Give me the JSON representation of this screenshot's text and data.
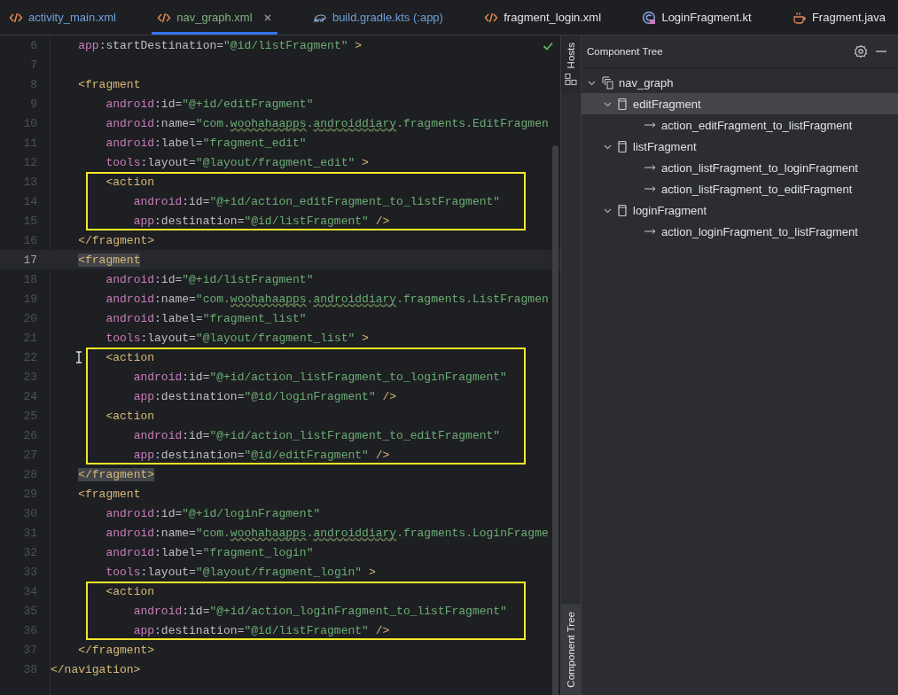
{
  "tabs": [
    {
      "label": "activity_main.xml",
      "kind": "xml",
      "selected": false,
      "closable": false,
      "color": "#6f9fd8"
    },
    {
      "label": "nav_graph.xml",
      "kind": "xml",
      "selected": true,
      "closable": true,
      "color": "#7fb07f"
    },
    {
      "label": "build.gradle.kts (:app)",
      "kind": "gradle",
      "selected": false,
      "closable": false,
      "color": "#6f9fd8"
    },
    {
      "label": "fragment_login.xml",
      "kind": "xml",
      "selected": false,
      "closable": false,
      "color": "#dfe1e5"
    },
    {
      "label": "LoginFragment.kt",
      "kind": "kotlin",
      "selected": false,
      "closable": false,
      "color": "#dfe1e5"
    },
    {
      "label": "Fragment.java",
      "kind": "java",
      "selected": false,
      "closable": false,
      "color": "#dfe1e5"
    }
  ],
  "editor": {
    "no_problems": true,
    "blocks": [
      {
        "boxed": false,
        "lines": [
          {
            "number": "6",
            "current": false,
            "tokens": [
              {
                "kind": "ns",
                "text": "    app"
              },
              {
                "kind": "plain",
                "text": ":startDestination="
              },
              {
                "kind": "value",
                "text": "\"@id/listFragment\""
              },
              {
                "kind": "tag",
                "text": " >"
              }
            ]
          },
          {
            "number": "7",
            "current": false
          },
          {
            "number": "8",
            "current": false,
            "tokens": [
              {
                "kind": "tag",
                "text": "    <fragment"
              }
            ]
          },
          {
            "number": "9",
            "current": false,
            "tokens": [
              {
                "kind": "ns",
                "text": "        android"
              },
              {
                "kind": "plain",
                "text": ":id="
              },
              {
                "kind": "value",
                "text": "\"@+id/editFragment\""
              }
            ]
          },
          {
            "number": "10",
            "current": false,
            "tokens": [
              {
                "kind": "ns",
                "text": "        android"
              },
              {
                "kind": "plain",
                "text": ":name="
              },
              {
                "kind": "value",
                "text": "\"com."
              },
              {
                "kind": "typo",
                "text": "woohahaapps"
              },
              {
                "kind": "value",
                "text": "."
              },
              {
                "kind": "typo",
                "text": "androiddiary"
              },
              {
                "kind": "value",
                "text": ".fragments.EditFragmen"
              }
            ]
          },
          {
            "number": "11",
            "current": false,
            "tokens": [
              {
                "kind": "ns",
                "text": "        android"
              },
              {
                "kind": "plain",
                "text": ":label="
              },
              {
                "kind": "value",
                "text": "\"fragment_edit\""
              }
            ]
          },
          {
            "number": "12",
            "current": false,
            "tokens": [
              {
                "kind": "ns",
                "text": "        tools"
              },
              {
                "kind": "plain",
                "text": ":layout="
              },
              {
                "kind": "value",
                "text": "\"@layout/fragment_edit\""
              },
              {
                "kind": "tag",
                "text": " >"
              }
            ]
          }
        ]
      },
      {
        "boxed": true,
        "lines": [
          {
            "number": "13",
            "current": false,
            "tokens": [
              {
                "kind": "tag",
                "text": "        <action"
              }
            ]
          },
          {
            "number": "14",
            "current": false,
            "tokens": [
              {
                "kind": "ns",
                "text": "            android"
              },
              {
                "kind": "plain",
                "text": ":id="
              },
              {
                "kind": "value",
                "text": "\"@+id/action_editFragment_to_listFragment\""
              }
            ]
          },
          {
            "number": "15",
            "current": false,
            "tokens": [
              {
                "kind": "ns",
                "text": "            app"
              },
              {
                "kind": "plain",
                "text": ":destination="
              },
              {
                "kind": "value",
                "text": "\"@id/listFragment\""
              },
              {
                "kind": "tag",
                "text": " />"
              }
            ]
          }
        ]
      },
      {
        "boxed": false,
        "lines": [
          {
            "number": "16",
            "current": false,
            "tokens": [
              {
                "kind": "tag",
                "text": "    </fragment>"
              }
            ]
          },
          {
            "number": "17",
            "current": true,
            "tokens": [
              {
                "kind": "tag_match",
                "text": "    <fragment"
              }
            ]
          },
          {
            "number": "18",
            "current": false,
            "tokens": [
              {
                "kind": "ns",
                "text": "        android"
              },
              {
                "kind": "plain",
                "text": ":id="
              },
              {
                "kind": "value",
                "text": "\"@+id/listFragment\""
              }
            ]
          },
          {
            "number": "19",
            "current": false,
            "tokens": [
              {
                "kind": "ns",
                "text": "        android"
              },
              {
                "kind": "plain",
                "text": ":name="
              },
              {
                "kind": "value",
                "text": "\"com."
              },
              {
                "kind": "typo",
                "text": "woohahaapps"
              },
              {
                "kind": "value",
                "text": "."
              },
              {
                "kind": "typo",
                "text": "androiddiary"
              },
              {
                "kind": "value",
                "text": ".fragments.ListFragmen"
              }
            ]
          },
          {
            "number": "20",
            "current": false,
            "tokens": [
              {
                "kind": "ns",
                "text": "        android"
              },
              {
                "kind": "plain",
                "text": ":label="
              },
              {
                "kind": "value",
                "text": "\"fragment_list\""
              }
            ]
          },
          {
            "number": "21",
            "current": false,
            "tokens": [
              {
                "kind": "ns",
                "text": "        tools"
              },
              {
                "kind": "plain",
                "text": ":layout="
              },
              {
                "kind": "value",
                "text": "\"@layout/fragment_list\""
              },
              {
                "kind": "tag",
                "text": " >"
              }
            ]
          }
        ]
      },
      {
        "boxed": true,
        "lines": [
          {
            "number": "22",
            "current": false,
            "tokens": [
              {
                "kind": "tag",
                "text": "        <action"
              }
            ]
          },
          {
            "number": "23",
            "current": false,
            "tokens": [
              {
                "kind": "ns",
                "text": "            android"
              },
              {
                "kind": "plain",
                "text": ":id="
              },
              {
                "kind": "value",
                "text": "\"@+id/action_listFragment_to_loginFragment\""
              }
            ]
          },
          {
            "number": "24",
            "current": false,
            "tokens": [
              {
                "kind": "ns",
                "text": "            app"
              },
              {
                "kind": "plain",
                "text": ":destination="
              },
              {
                "kind": "value",
                "text": "\"@id/loginFragment\""
              },
              {
                "kind": "tag",
                "text": " />"
              }
            ]
          },
          {
            "number": "25",
            "current": false,
            "tokens": [
              {
                "kind": "tag",
                "text": "        <action"
              }
            ]
          },
          {
            "number": "26",
            "current": false,
            "tokens": [
              {
                "kind": "ns",
                "text": "            android"
              },
              {
                "kind": "plain",
                "text": ":id="
              },
              {
                "kind": "value",
                "text": "\"@+id/action_listFragment_to_editFragment\""
              }
            ]
          },
          {
            "number": "27",
            "current": false,
            "tokens": [
              {
                "kind": "ns",
                "text": "            app"
              },
              {
                "kind": "plain",
                "text": ":destination="
              },
              {
                "kind": "value",
                "text": "\"@id/editFragment\""
              },
              {
                "kind": "tag",
                "text": " />"
              }
            ]
          }
        ]
      },
      {
        "boxed": false,
        "lines": [
          {
            "number": "28",
            "current": false,
            "tokens": [
              {
                "kind": "tag_match",
                "text": "    </fragment>"
              }
            ]
          },
          {
            "number": "29",
            "current": false,
            "tokens": [
              {
                "kind": "tag",
                "text": "    <fragment"
              }
            ]
          },
          {
            "number": "30",
            "current": false,
            "tokens": [
              {
                "kind": "ns",
                "text": "        android"
              },
              {
                "kind": "plain",
                "text": ":id="
              },
              {
                "kind": "value",
                "text": "\"@+id/loginFragment\""
              }
            ]
          },
          {
            "number": "31",
            "current": false,
            "tokens": [
              {
                "kind": "ns",
                "text": "        android"
              },
              {
                "kind": "plain",
                "text": ":name="
              },
              {
                "kind": "value",
                "text": "\"com."
              },
              {
                "kind": "typo",
                "text": "woohahaapps"
              },
              {
                "kind": "value",
                "text": "."
              },
              {
                "kind": "typo",
                "text": "androiddiary"
              },
              {
                "kind": "value",
                "text": ".fragments.LoginFragme"
              }
            ]
          },
          {
            "number": "32",
            "current": false,
            "tokens": [
              {
                "kind": "ns",
                "text": "        android"
              },
              {
                "kind": "plain",
                "text": ":label="
              },
              {
                "kind": "value",
                "text": "\"fragment_login\""
              }
            ]
          },
          {
            "number": "33",
            "current": false,
            "tokens": [
              {
                "kind": "ns",
                "text": "        tools"
              },
              {
                "kind": "plain",
                "text": ":layout="
              },
              {
                "kind": "value",
                "text": "\"@layout/fragment_login\""
              },
              {
                "kind": "tag",
                "text": " >"
              }
            ]
          }
        ]
      },
      {
        "boxed": true,
        "lines": [
          {
            "number": "34",
            "current": false,
            "tokens": [
              {
                "kind": "tag",
                "text": "        <action"
              }
            ]
          },
          {
            "number": "35",
            "current": false,
            "tokens": [
              {
                "kind": "ns",
                "text": "            android"
              },
              {
                "kind": "plain",
                "text": ":id="
              },
              {
                "kind": "value",
                "text": "\"@+id/action_loginFragment_to_listFragment\""
              }
            ]
          },
          {
            "number": "36",
            "current": false,
            "tokens": [
              {
                "kind": "ns",
                "text": "            app"
              },
              {
                "kind": "plain",
                "text": ":destination="
              },
              {
                "kind": "value",
                "text": "\"@id/listFragment\""
              },
              {
                "kind": "tag",
                "text": " />"
              }
            ]
          }
        ]
      },
      {
        "boxed": false,
        "lines": [
          {
            "number": "37",
            "current": false,
            "tokens": [
              {
                "kind": "tag",
                "text": "    </fragment>"
              }
            ]
          },
          {
            "number": "38",
            "current": false,
            "tokens": [
              {
                "kind": "tag",
                "text": "</navigation>"
              }
            ]
          }
        ]
      }
    ]
  },
  "side_tabs": [
    {
      "label": "Hosts",
      "kind": "hosts",
      "selected": false
    },
    {
      "label": "Component Tree",
      "kind": "tree",
      "selected": true
    }
  ],
  "component_tree": {
    "title": "Component Tree",
    "nodes": [
      {
        "label": "nav_graph",
        "kind": "graph",
        "expanded": true,
        "selected": false,
        "children": [
          {
            "label": "editFragment",
            "kind": "fragment",
            "expanded": true,
            "selected": true,
            "children": [
              {
                "label": "action_editFragment_to_listFragment",
                "kind": "action",
                "selected": false
              }
            ]
          },
          {
            "label": "listFragment",
            "kind": "fragment",
            "expanded": true,
            "selected": false,
            "children": [
              {
                "label": "action_listFragment_to_loginFragment",
                "kind": "action",
                "selected": false
              },
              {
                "label": "action_listFragment_to_editFragment",
                "kind": "action",
                "selected": false
              }
            ]
          },
          {
            "label": "loginFragment",
            "kind": "fragment",
            "expanded": true,
            "selected": false,
            "children": [
              {
                "label": "action_loginFragment_to_listFragment",
                "kind": "action",
                "selected": false
              }
            ]
          }
        ]
      }
    ]
  }
}
